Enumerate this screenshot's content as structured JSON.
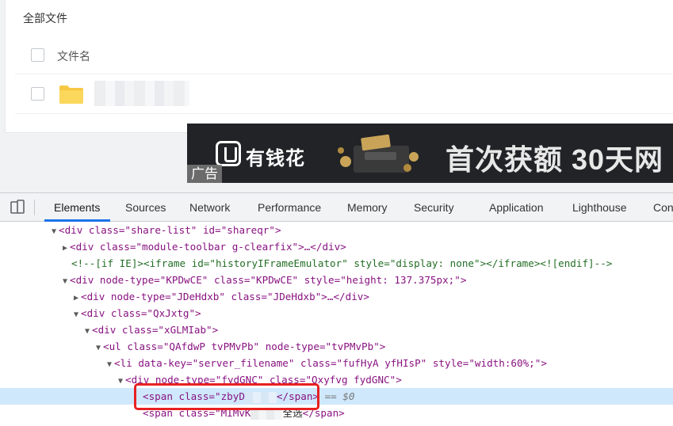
{
  "file_panel": {
    "title": "全部文件",
    "column_header": "文件名"
  },
  "ad": {
    "brand": "有钱花",
    "slogan": "首次获额 30天网",
    "tag": "广告"
  },
  "devtools": {
    "tabs": [
      "Elements",
      "Sources",
      "Network",
      "Performance",
      "Memory",
      "Security",
      "Application",
      "Lighthouse",
      "Con"
    ],
    "active_tab": "Elements",
    "dom_lines": {
      "l1_tag": "<div class=\"share-list\" id=\"shareqr\">",
      "l2_tag": "<div class=\"module-toolbar g-clearfix\">…</div>",
      "l3_comment": "<!--[if IE]><iframe id=\"historyIFrameEmulator\" style=\"display: none\"></iframe><![endif]-->",
      "l4_tag": "<div node-type=\"KPDwCE\" class=\"KPDwCE\" style=\"height: 137.375px;\">",
      "l5_tag": "<div node-type=\"JDeHdxb\" class=\"JDeHdxb\">…</div>",
      "l6_tag": "<div class=\"QxJxtg\">",
      "l7_tag": "<div class=\"xGLMIab\">",
      "l8_tag": "<ul class=\"QAfdwP tvPMvPb\" node-type=\"tvPMvPb\">",
      "l9_tag": "<li data-key=\"server_filename\" class=\"fufHyA yfHIsP\" style=\"width:60%;\">",
      "l10_tag": "<div node-type=\"fydGNC\" class=\"Qxyfvg fydGNC\">",
      "l11_open": "<span class=\"zbyD",
      "l11_close": "</span>",
      "l11_hint": "== $0",
      "l12_open": "<span class=\"MIMvK",
      "l12_text": "全选",
      "l12_close": "</span>"
    }
  }
}
